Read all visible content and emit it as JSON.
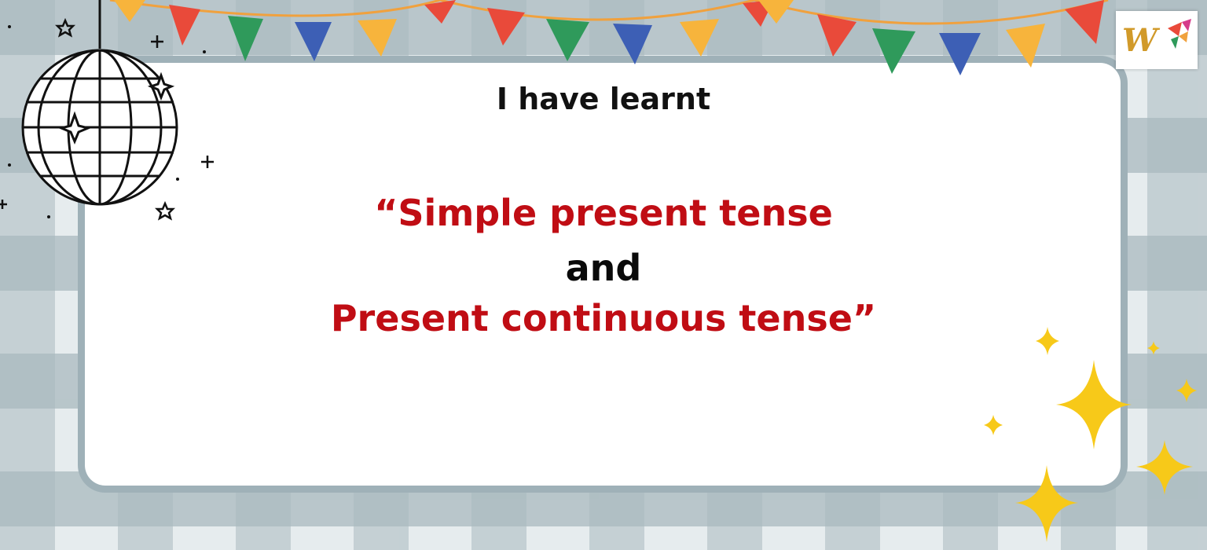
{
  "slide": {
    "heading": "I have learnt",
    "line1": "“Simple present tense",
    "line2": "and",
    "line3": "Present continuous tense”"
  },
  "logo": {
    "letter": "W",
    "icon": "brand-logo-icon"
  },
  "decorations": {
    "icons": [
      "disco-ball-icon",
      "bunting-flags",
      "sparkle-icon",
      "star-icon"
    ]
  },
  "colors": {
    "accent_red": "#c00d14",
    "text": "#111111",
    "frame": "#9fb1b8",
    "sparkle": "#f7c919"
  }
}
